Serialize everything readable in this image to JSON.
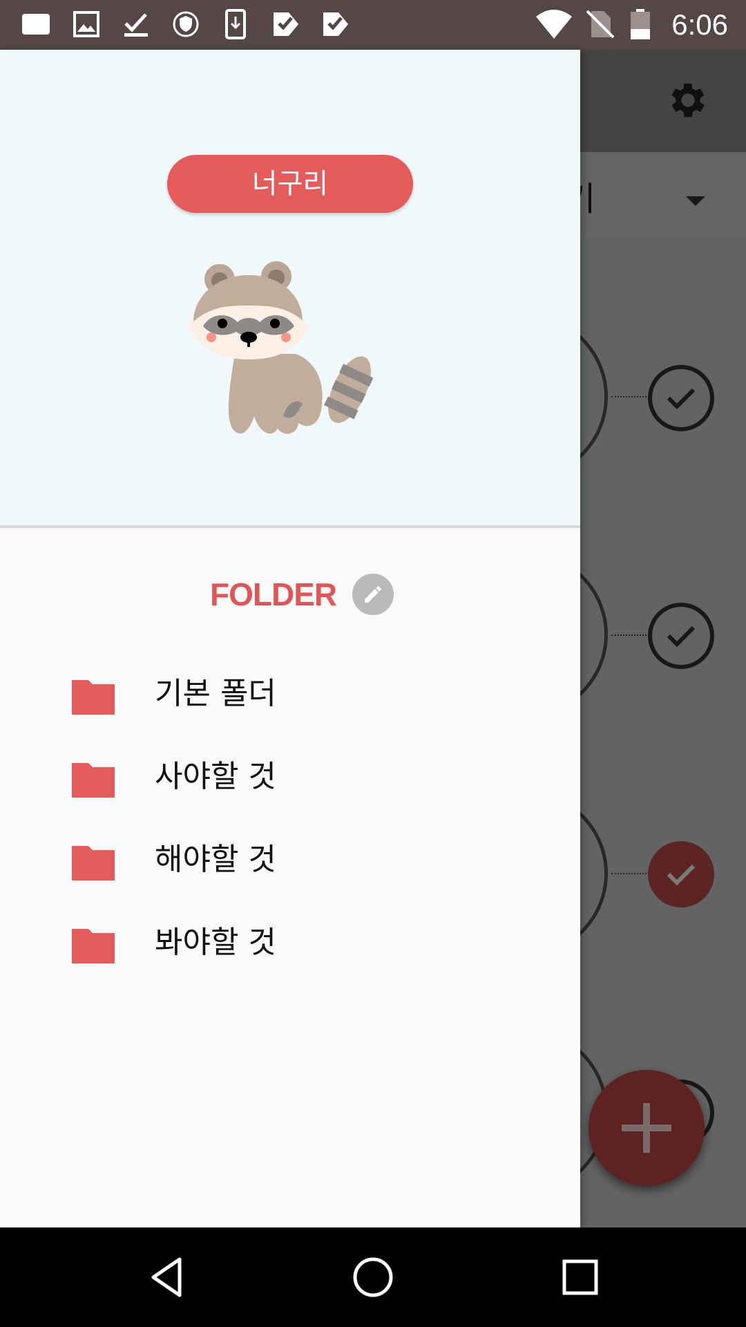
{
  "status_bar": {
    "time": "6:06",
    "left_icons": [
      "notification-note-icon",
      "image-icon",
      "download-done-icon",
      "vpn-shield-icon",
      "phone-download-icon",
      "check-app-icon",
      "check-app-icon"
    ],
    "right_icons": [
      "wifi-icon",
      "no-sim-icon",
      "battery-icon"
    ]
  },
  "background_app": {
    "toolbar_icon": "gear-icon",
    "folder_selector_text": "기",
    "tasks": [
      {
        "done": false
      },
      {
        "done": false
      },
      {
        "done": true
      },
      {
        "done": false
      }
    ],
    "fab_icon": "plus-icon"
  },
  "drawer": {
    "profile_name": "너구리",
    "mascot": "raccoon",
    "folder_heading": "FOLDER",
    "folders": [
      {
        "label": "기본 폴더"
      },
      {
        "label": "사야할 것"
      },
      {
        "label": "해야할 것"
      },
      {
        "label": "봐야할 것"
      }
    ]
  },
  "colors": {
    "accent": "#e55b5b",
    "header_bg": "#f0f8fa",
    "status_bar": "#554748"
  },
  "nav_bar": [
    "back-icon",
    "home-icon",
    "recents-icon"
  ]
}
